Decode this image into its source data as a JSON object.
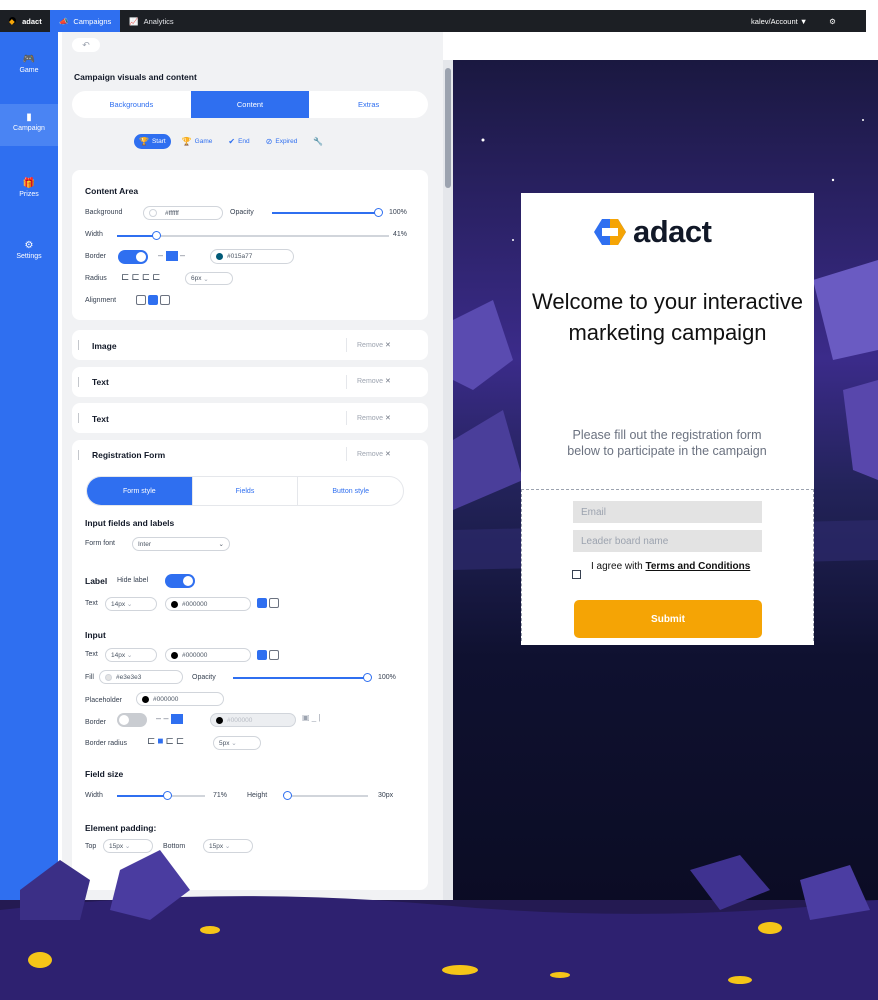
{
  "topbar": {
    "logo": "adact",
    "nav": [
      {
        "label": "Campaigns",
        "icon": "megaphone-icon"
      },
      {
        "label": "Analytics",
        "icon": "chart-icon"
      }
    ],
    "account": "kalev/Account"
  },
  "rail": [
    {
      "label": "Game",
      "icon": "gamepad-icon"
    },
    {
      "label": "Campaign",
      "icon": "campaign-icon"
    },
    {
      "label": "Prizes",
      "icon": "gift-icon"
    },
    {
      "label": "Settings",
      "icon": "gear-icon"
    }
  ],
  "panel": {
    "section_title": "Campaign visuals and content",
    "tabs": [
      "Backgrounds",
      "Content",
      "Extras"
    ],
    "subtabs": [
      "Start",
      "Game",
      "End",
      "Expired"
    ],
    "content_area": {
      "title": "Content Area",
      "background_label": "Background",
      "background_value": "#ffffff",
      "opacity_label": "Opacity",
      "opacity_value": "100%",
      "width_label": "Width",
      "width_value": "41%",
      "border_label": "Border",
      "border_color": "#015a77",
      "radius_label": "Radius",
      "radius_value": "6px",
      "alignment_label": "Alignment"
    },
    "blocks": [
      {
        "title": "Image",
        "remove": "Remove"
      },
      {
        "title": "Text",
        "remove": "Remove"
      },
      {
        "title": "Text",
        "remove": "Remove"
      },
      {
        "title": "Registration Form",
        "remove": "Remove"
      }
    ],
    "form_tabs": [
      "Form style",
      "Fields",
      "Button style"
    ],
    "inputs_section": {
      "title": "Input fields and labels",
      "font_label": "Form font",
      "font_value": "Inter"
    },
    "label_section": {
      "title": "Label",
      "hide_label": "Hide label",
      "text_label": "Text",
      "text_size": "14px",
      "text_color": "#000000"
    },
    "input_section": {
      "title": "Input",
      "text_label": "Text",
      "text_size": "14px",
      "text_color": "#000000",
      "fill_label": "Fill",
      "fill_color": "#e3e3e3",
      "opacity_label": "Opacity",
      "opacity_value": "100%",
      "placeholder_label": "Placeholder",
      "placeholder_color": "#000000",
      "border_label": "Border",
      "border_color": "#000000",
      "radius_label": "Border radius",
      "radius_value": "5px"
    },
    "field_size": {
      "title": "Field size",
      "width_label": "Width",
      "width_value": "71%",
      "height_label": "Height",
      "height_value": "30px"
    },
    "padding": {
      "title": "Element padding:",
      "top_label": "Top",
      "top_value": "15px",
      "bottom_label": "Bottom",
      "bottom_value": "15px"
    }
  },
  "preview": {
    "brand": "adact",
    "title": "Welcome to your interactive marketing campaign",
    "subtitle": "Please fill out the registration form below to participate in the campaign",
    "email_placeholder": "Email",
    "leaderboard_placeholder": "Leader board name",
    "agree_text": "I agree with",
    "terms_link": "Terms and Conditions",
    "submit": "Submit"
  },
  "colors": {
    "accent": "#2f6ff0",
    "topbar": "#1c1f24",
    "submit": "#f5a405",
    "preview_bg": "#121431"
  }
}
